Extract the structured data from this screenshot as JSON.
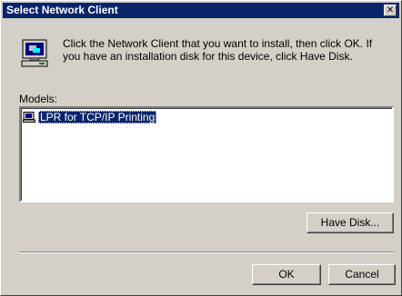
{
  "window": {
    "title": "Select Network Client",
    "close_glyph": "✕"
  },
  "instructions": "Click the Network Client that you want to install, then click OK. If you have an installation disk for this device, click Have Disk.",
  "models": {
    "label": "Models:",
    "items": [
      {
        "label": "LPR for TCP/IP Printing",
        "icon": "network-client-icon",
        "selected": true
      }
    ]
  },
  "buttons": {
    "have_disk": "Have Disk...",
    "ok": "OK",
    "cancel": "Cancel"
  },
  "colors": {
    "titlebar": "#0a246a",
    "face": "#d4d0c8",
    "selection": "#0a246a"
  }
}
